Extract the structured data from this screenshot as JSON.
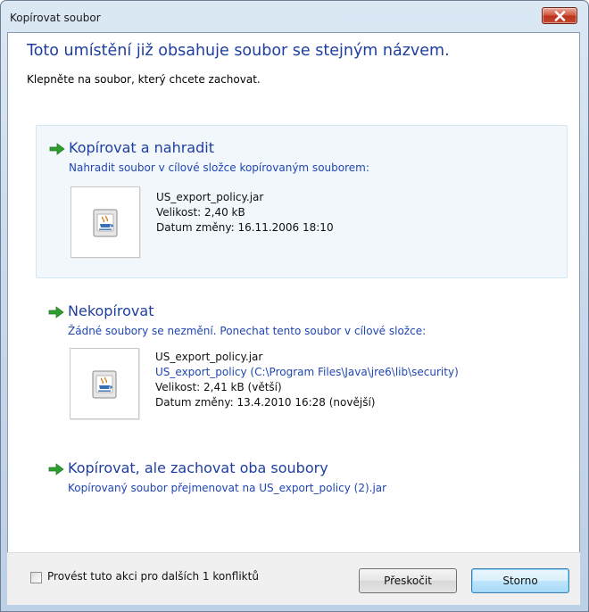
{
  "window": {
    "title": "Kopírovat soubor"
  },
  "dialog": {
    "heading": "Toto umístění již obsahuje soubor se stejným názvem.",
    "subheading": "Klepněte na soubor, který chcete zachovat."
  },
  "options": [
    {
      "title": "Kopírovat a nahradit",
      "description": "Nahradit soubor v cílové složce kopírovaným souborem:",
      "file": {
        "name": "US_export_policy.jar",
        "size": "Velikost: 2,40 kB",
        "modified": "Datum změny: 16.11.2006 18:10"
      }
    },
    {
      "title": "Nekopírovat",
      "description": "Žádné soubory se nezmění. Ponechat tento soubor v cílové složce:",
      "file": {
        "name": "US_export_policy.jar",
        "path": "US_export_policy (C:\\Program Files\\Java\\jre6\\lib\\security)",
        "size": "Velikost: 2,41 kB (větší)",
        "modified": "Datum změny: 13.4.2010 16:28 (novější)"
      }
    },
    {
      "title": "Kopírovat, ale zachovat oba soubory",
      "description": "Kopírovaný soubor přejmenovat na US_export_policy (2).jar"
    }
  ],
  "footer": {
    "checkbox_label": "Provést tuto akci pro dalších 1 konfliktů",
    "checkbox_checked": false,
    "skip_label": "Přeskočit",
    "cancel_label": "Storno"
  },
  "icons": {
    "close": "close-icon",
    "arrow": "green-arrow-icon",
    "file": "java-jar-file-icon"
  },
  "colors": {
    "heading": "#1f3fa0",
    "link": "#2046b3",
    "arrow": "#2e9f2e",
    "close": "#c7482e"
  }
}
